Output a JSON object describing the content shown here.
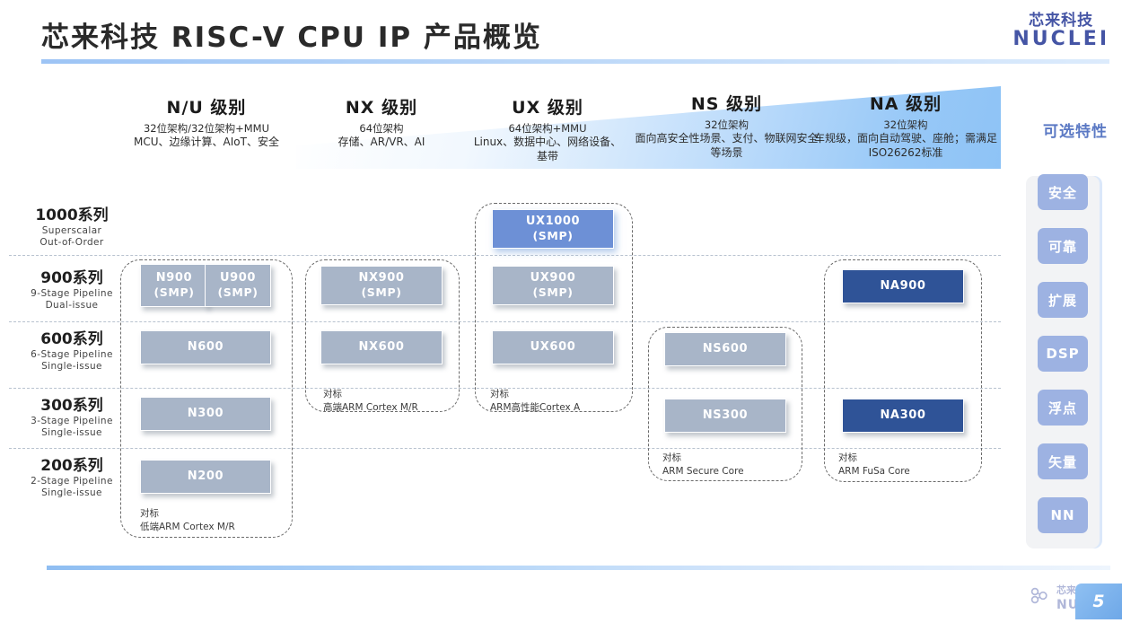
{
  "header": {
    "title": "芯来科技 RISC-V CPU IP 产品概览",
    "logo_cn": "芯来科技",
    "logo_en": "NUCLEI"
  },
  "columns": [
    {
      "id": "nu",
      "title": "N/U 级别",
      "arch": "32位架构/32位架构+MMU",
      "apps": "MCU、边缘计算、AIoT、安全"
    },
    {
      "id": "nx",
      "title": "NX 级别",
      "arch": "64位架构",
      "apps": "存储、AR/VR、AI"
    },
    {
      "id": "ux",
      "title": "UX 级别",
      "arch": "64位架构+MMU",
      "apps": "Linux、数据中心、网络设备、基带"
    },
    {
      "id": "ns",
      "title": "NS 级别",
      "arch": "32位架构",
      "apps": "面向高安全性场景、支付、物联网安全等场景"
    },
    {
      "id": "na",
      "title": "NA 级别",
      "arch": "32位架构",
      "apps": "车规级，面向自动驾驶、座舱；需满足ISO26262标准"
    }
  ],
  "rows": [
    {
      "id": "s1000",
      "title": "1000系列",
      "line1": "Superscalar",
      "line2": "Out-of-Order"
    },
    {
      "id": "s900",
      "title": "900系列",
      "line1": "9-Stage Pipeline",
      "line2": "Dual-issue"
    },
    {
      "id": "s600",
      "title": "600系列",
      "line1": "6-Stage Pipeline",
      "line2": "Single-issue"
    },
    {
      "id": "s300",
      "title": "300系列",
      "line1": "3-Stage Pipeline",
      "line2": "Single-issue"
    },
    {
      "id": "s200",
      "title": "200系列",
      "line1": "2-Stage Pipeline",
      "line2": "Single-issue"
    }
  ],
  "cores": [
    {
      "id": "n900",
      "name": "N900",
      "note": "(SMP)",
      "style": "gray"
    },
    {
      "id": "u900",
      "name": "U900",
      "note": "(SMP)",
      "style": "gray"
    },
    {
      "id": "n600",
      "name": "N600",
      "note": "",
      "style": "gray"
    },
    {
      "id": "n300",
      "name": "N300",
      "note": "",
      "style": "gray"
    },
    {
      "id": "n200",
      "name": "N200",
      "note": "",
      "style": "gray"
    },
    {
      "id": "nx900",
      "name": "NX900",
      "note": "(SMP)",
      "style": "gray"
    },
    {
      "id": "nx600",
      "name": "NX600",
      "note": "",
      "style": "gray"
    },
    {
      "id": "ux1000",
      "name": "UX1000",
      "note": "(SMP)",
      "style": "blue"
    },
    {
      "id": "ux900",
      "name": "UX900",
      "note": "(SMP)",
      "style": "gray"
    },
    {
      "id": "ux600",
      "name": "UX600",
      "note": "",
      "style": "gray"
    },
    {
      "id": "ns600",
      "name": "NS600",
      "note": "",
      "style": "gray"
    },
    {
      "id": "ns300",
      "name": "NS300",
      "note": "",
      "style": "gray"
    },
    {
      "id": "na900",
      "name": "NA900",
      "note": "",
      "style": "navy"
    },
    {
      "id": "na300",
      "name": "NA300",
      "note": "",
      "style": "navy"
    }
  ],
  "benchmarks": [
    {
      "id": "bm-nu",
      "label": "对标",
      "target": "低端ARM Cortex M/R"
    },
    {
      "id": "bm-nx",
      "label": "对标",
      "target": "高端ARM Cortex M/R"
    },
    {
      "id": "bm-ux",
      "label": "对标",
      "target": "ARM高性能Cortex A"
    },
    {
      "id": "bm-ns",
      "label": "对标",
      "target": "ARM Secure Core"
    },
    {
      "id": "bm-na",
      "label": "对标",
      "target": "ARM FuSa Core"
    }
  ],
  "optional": {
    "label": "可选特性",
    "items": [
      {
        "id": "opt-security",
        "label": "安全"
      },
      {
        "id": "opt-reliable",
        "label": "可靠"
      },
      {
        "id": "opt-extend",
        "label": "扩展"
      },
      {
        "id": "opt-dsp",
        "label": "DSP"
      },
      {
        "id": "opt-float",
        "label": "浮点"
      },
      {
        "id": "opt-vector",
        "label": "矢量"
      },
      {
        "id": "opt-nn",
        "label": "NN"
      }
    ]
  },
  "footer": {
    "logo_cn": "芯来科技",
    "logo_en": "NUCL",
    "page_number": "5"
  },
  "colors": {
    "accent_blue": "#6d90d6",
    "navy": "#2f5397",
    "gray_blue": "#a8b5c8",
    "brand": "#4555a5",
    "optional_chip": "#9db2e2"
  }
}
